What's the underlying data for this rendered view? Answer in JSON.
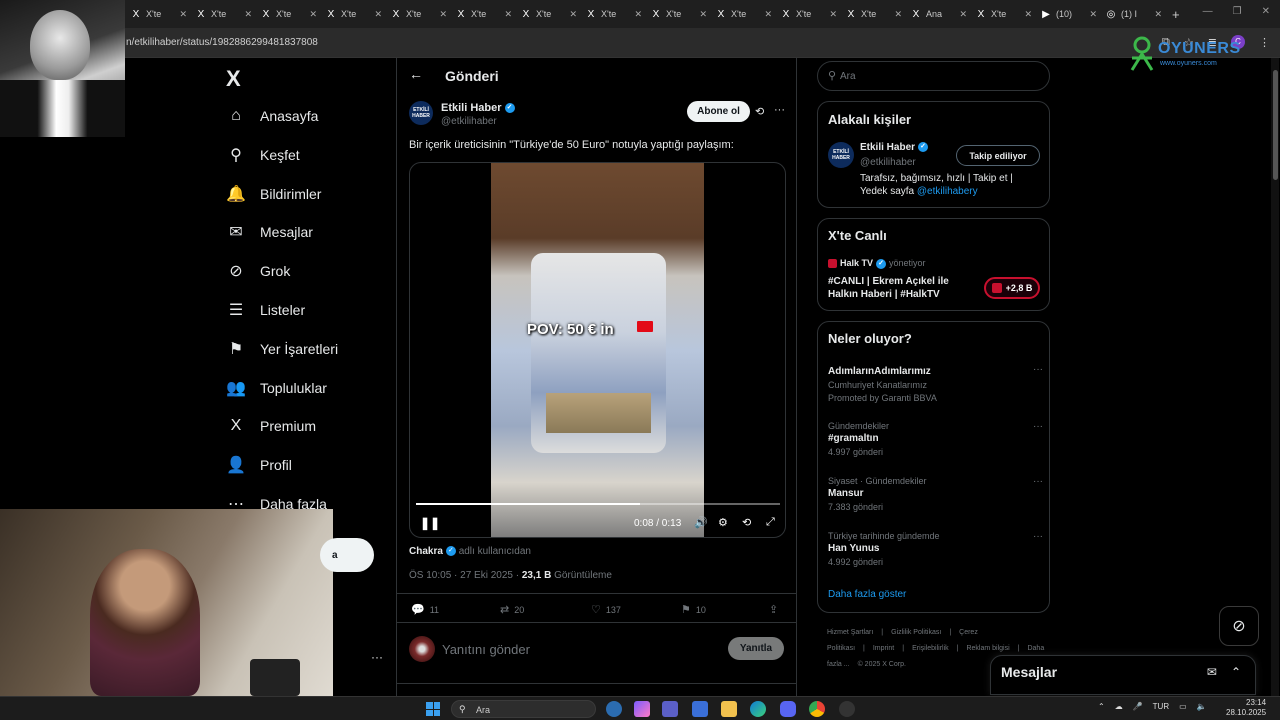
{
  "browser": {
    "tabs": [
      {
        "icon": "X",
        "label": "X'te"
      },
      {
        "icon": "X",
        "label": "X'te"
      },
      {
        "icon": "X",
        "label": "X'te"
      },
      {
        "icon": "X",
        "label": "X'te"
      },
      {
        "icon": "X",
        "label": "X'te"
      },
      {
        "icon": "X",
        "label": "X'te"
      },
      {
        "icon": "X",
        "label": "X'te"
      },
      {
        "icon": "X",
        "label": "X'te"
      },
      {
        "icon": "X",
        "label": "X'te"
      },
      {
        "icon": "X",
        "label": "X'te"
      },
      {
        "icon": "X",
        "label": "X'te"
      },
      {
        "icon": "X",
        "label": "X'te"
      },
      {
        "icon": "X",
        "label": "Ana"
      },
      {
        "icon": "X",
        "label": "X'te"
      },
      {
        "icon": "▶",
        "label": "(10)"
      },
      {
        "icon": "◎",
        "label": "(1) I"
      }
    ],
    "new_tab": "+",
    "url": "n/etkilihaber/status/1982886299481837808",
    "profile_initial": "C",
    "watermark_text": "OYUNERS",
    "watermark_sub": "www.oyuners.com"
  },
  "nav": {
    "logo": "X",
    "items": [
      {
        "icon": "⌂",
        "label": "Anasayfa"
      },
      {
        "icon": "⚲",
        "label": "Keşfet"
      },
      {
        "icon": "🔔",
        "label": "Bildirimler"
      },
      {
        "icon": "✉",
        "label": "Mesajlar"
      },
      {
        "icon": "⊘",
        "label": "Grok"
      },
      {
        "icon": "☰",
        "label": "Listeler"
      },
      {
        "icon": "⚑",
        "label": "Yer İşaretleri"
      },
      {
        "icon": "👥",
        "label": "Topluluklar"
      },
      {
        "icon": "X",
        "label": "Premium"
      },
      {
        "icon": "👤",
        "label": "Profil"
      },
      {
        "icon": "⋯",
        "label": "Daha fazla"
      }
    ],
    "post_button": "a",
    "more": "···"
  },
  "post": {
    "header_title": "Gönderi",
    "back": "←",
    "author_name": "Etkili Haber",
    "author_handle": "@etkilihaber",
    "avatar_text": "ETKİLİ HABER",
    "subscribe": "Abone ol",
    "text": "Bir içerik üreticisinin \"Türkiye'de 50 Euro\" notuyla yaptığı paylaşım:",
    "video": {
      "caption": "POV: 50 € in",
      "time": "0:08 / 0:13",
      "progress": 0.615
    },
    "byline_name": "Chakra",
    "byline_suffix": "adlı kullanıcıdan",
    "timestamp": "ÖS 10:05 · 27 Eki 2025 ·",
    "views_count": "23,1 B",
    "views_label": "Görüntüleme",
    "stats": {
      "replies": "11",
      "reposts": "20",
      "likes": "137",
      "bookmarks": "10"
    },
    "reply_placeholder": "Yanıtını gönder",
    "reply_button": "Yanıtla"
  },
  "sidebar": {
    "search_placeholder": "Ara",
    "related": {
      "title": "Alakalı kişiler",
      "name": "Etkili Haber",
      "handle": "@etkilihaber",
      "avatar_text": "ETKİLİ HABER",
      "follow_label": "Takip ediliyor",
      "bio": "Tarafsız, bağımsız, hızlı | Takip et | Yedek sayfa",
      "bio_mention": "@etkilihabery"
    },
    "live": {
      "title": "X'te Canlı",
      "host": "Halk TV",
      "host_role": "yönetiyor",
      "stream_title": "#CANLI | Ekrem Açıkel ile Halkın Haberi | #HalkTV",
      "listeners": "+2,8 B"
    },
    "trends": {
      "title": "Neler oluyor?",
      "items": [
        {
          "meta": "",
          "name": "AdımlarınAdımlarımız",
          "count": "Cumhuriyet Kanatlarımız",
          "promo": "Promoted by Garanti BBVA"
        },
        {
          "meta": "Gündemdekiler",
          "name": "#gramaltın",
          "count": "4.997 gönderi",
          "promo": ""
        },
        {
          "meta": "Siyaset · Gündemdekiler",
          "name": "Mansur",
          "count": "7.383 gönderi",
          "promo": ""
        },
        {
          "meta": "Türkiye tarihinde gündemde",
          "name": "Han Yunus",
          "count": "4.992 gönderi",
          "promo": ""
        }
      ],
      "show_more": "Daha fazla göster"
    },
    "footer": [
      "Hizmet Şartları",
      "|",
      "Gizlilik Politikası",
      "|",
      "Çerez Politikası",
      "|",
      "Imprint",
      "|",
      "Erişilebilirlik",
      "|",
      "Reklam bilgisi",
      "|",
      "Daha fazla ...",
      "© 2025 X Corp."
    ]
  },
  "messages_drawer": {
    "title": "Mesajlar"
  },
  "taskbar": {
    "search": "Ara",
    "lang": "TUR",
    "time": "23:14",
    "date": "28.10.2025"
  }
}
